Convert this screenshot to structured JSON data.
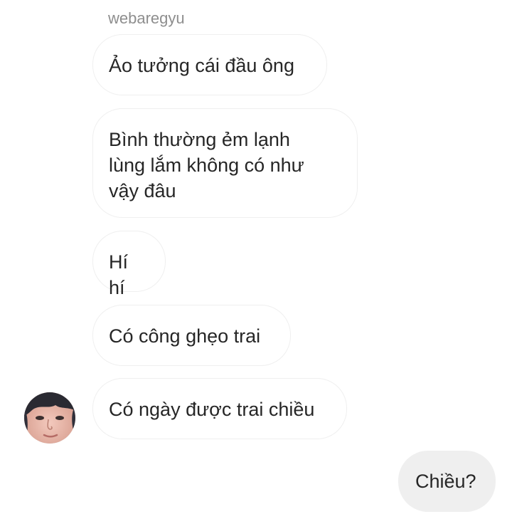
{
  "thread": {
    "sender_username": "webaregyu",
    "incoming_messages": [
      {
        "text": "Ảo tưởng cái đầu ông"
      },
      {
        "text": "Bình thường ẻm lạnh\nlùng lắm không có như\nvậy đâu"
      },
      {
        "text": "Hí hí"
      },
      {
        "text": "Có công ghẹo trai"
      },
      {
        "text": "Có ngày được trai chiều"
      }
    ],
    "outgoing_messages": [
      {
        "text": "Chiều?"
      }
    ],
    "avatar_icon": "user-avatar-photo"
  },
  "colors": {
    "incoming_bubble_border": "#efefef",
    "outgoing_bubble_bg": "#efefef",
    "text": "#262626",
    "username": "#8e8e8e"
  }
}
